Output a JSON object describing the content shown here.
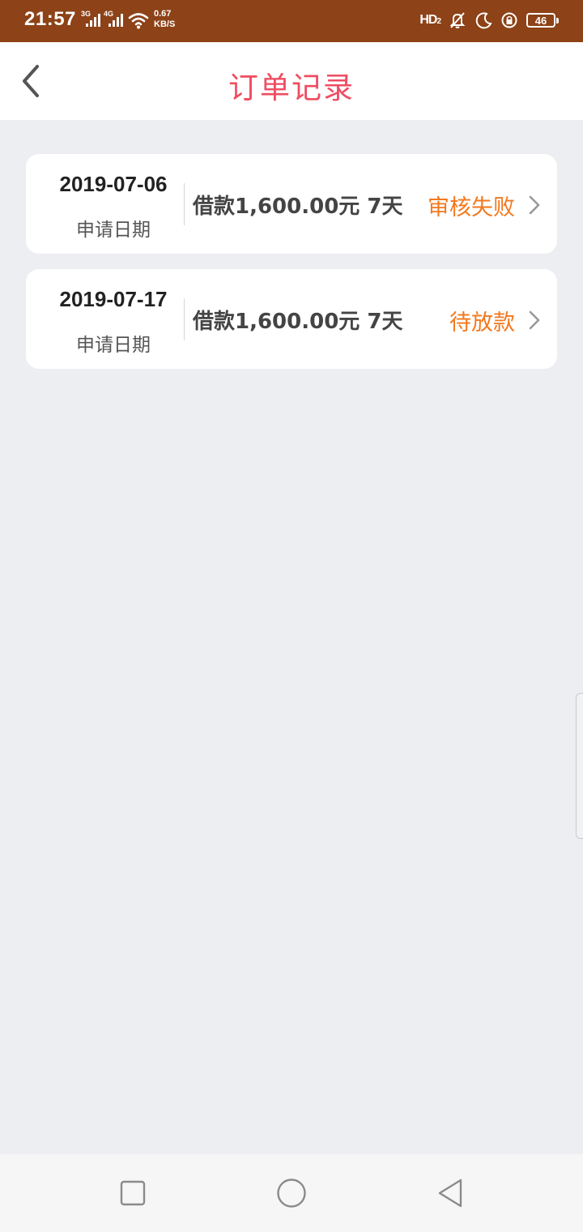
{
  "status_bar": {
    "time": "21:57",
    "sim1_type": "3G",
    "sim2_type": "4G",
    "speed_value": "0.67",
    "speed_unit": "KB/S",
    "hd_label": "HD",
    "hd_sub": "2",
    "battery": "46"
  },
  "header": {
    "title": "订单记录"
  },
  "orders": [
    {
      "date": "2019-07-06",
      "date_label": "申请日期",
      "amount": "借款1,600.00元 7天",
      "status": "审核失败"
    },
    {
      "date": "2019-07-17",
      "date_label": "申请日期",
      "amount": "借款1,600.00元 7天",
      "status": "待放款"
    }
  ],
  "colors": {
    "status_bar": "#8d4217",
    "title": "#ef4d62",
    "status_text": "#f2781e",
    "background": "#edeef2"
  },
  "icons": {
    "back": "chevron-left-icon",
    "row_arrow": "chevron-right-icon",
    "nav_recent": "square-icon",
    "nav_home": "circle-icon",
    "nav_back": "triangle-back-icon"
  }
}
